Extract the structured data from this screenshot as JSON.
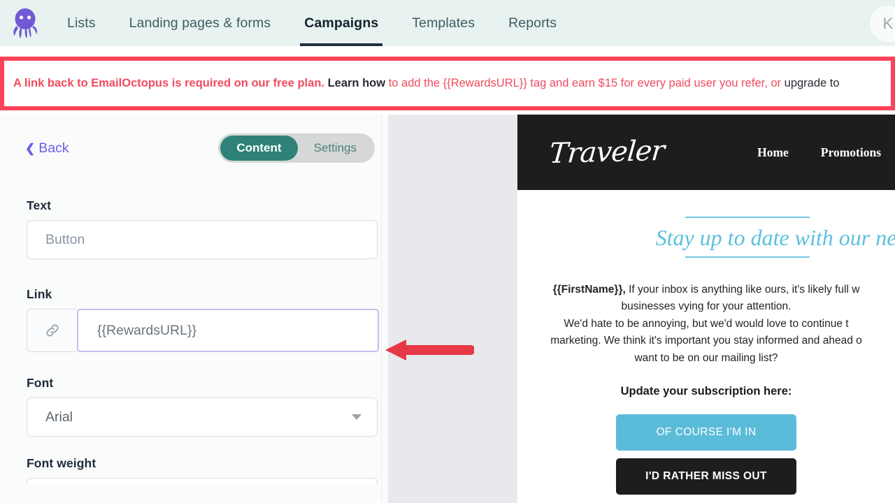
{
  "topnav": {
    "logo_icon": "octopus-logo",
    "items": [
      {
        "label": "Lists",
        "active": false
      },
      {
        "label": "Landing pages & forms",
        "active": false
      },
      {
        "label": "Campaigns",
        "active": true
      },
      {
        "label": "Templates",
        "active": false
      },
      {
        "label": "Reports",
        "active": false
      }
    ],
    "avatar_initial": "K"
  },
  "banner": {
    "part1": "A link back to EmailOctopus is required on our free plan.",
    "part2": "Learn how",
    "part3": "to add the {{RewardsURL}} tag and earn $15 for every paid user you refer, or",
    "part4": "upgrade to",
    "border_color": "#fb4459",
    "text_color": "#f04b5e"
  },
  "panel": {
    "back_label": "Back",
    "back_icon": "chevron-left-icon",
    "tabs": [
      {
        "label": "Content",
        "active": true
      },
      {
        "label": "Settings",
        "active": false
      }
    ],
    "text_field": {
      "label": "Text",
      "value": "Button",
      "placeholder": "Button"
    },
    "link_field": {
      "label": "Link",
      "icon": "link-chain-icon",
      "value": "{{RewardsURL}}",
      "placeholder": "{{RewardsURL}}",
      "focused": true
    },
    "font_field": {
      "label": "Font",
      "value": "Arial",
      "caret_icon": "chevron-down-icon"
    },
    "font_weight_field": {
      "label": "Font weight"
    }
  },
  "preview": {
    "header": {
      "logo_text": "Traveler",
      "nav": [
        "Home",
        "Promotions"
      ]
    },
    "headline": "Stay up to date with our ne",
    "body_lines": [
      {
        "bold": "{{FirstName}},",
        "rest": " If your inbox is anything like ours, it's likely full w"
      },
      {
        "bold": "",
        "rest": "businesses vying for your attention."
      },
      {
        "bold": "",
        "rest": "We'd hate to be annoying, but we'd would love to continue t"
      },
      {
        "bold": "",
        "rest": "marketing. We think it's important you stay informed and ahead o"
      },
      {
        "bold": "",
        "rest": "want to be on our mailing list?"
      }
    ],
    "subheading": "Update your subscription here:",
    "cta_primary": "OF COURSE I'M IN",
    "cta_secondary": "I'D RATHER MISS OUT",
    "accent_blue": "#5bc0de",
    "dark": "#1d1d1d"
  },
  "annotation": {
    "arrow_color": "#e63946",
    "arrow_direction": "left"
  }
}
